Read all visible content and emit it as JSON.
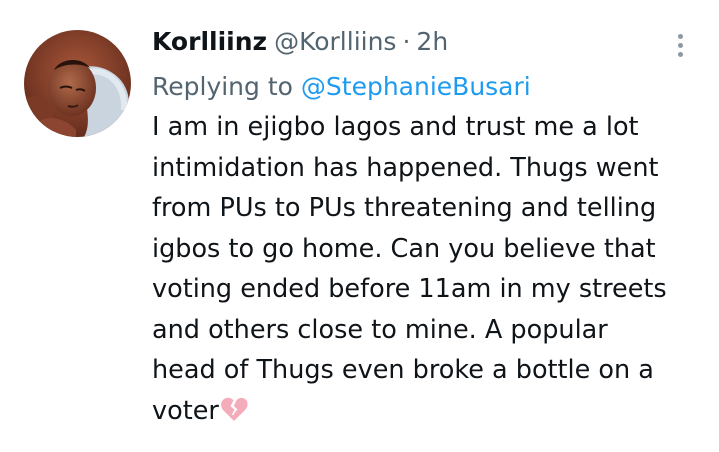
{
  "author": {
    "display_name": "Korlliinz",
    "handle": "@Korlliins",
    "separator": "·",
    "timestamp": "2h"
  },
  "reply": {
    "prefix": "Replying to",
    "mention": "@StephanieBusari"
  },
  "tweet": {
    "lines": [
      "I am in ejigbo lagos and trust me a lot",
      "intimidation has happened. Thugs went",
      "from PUs to PUs threatening and telling",
      "igbos to go home. Can you believe that",
      "voting ended before 11am in my streets",
      "and others close to mine. A popular",
      "head of Thugs even broke a bottle on a",
      "voter"
    ],
    "emoji": "broken-heart-icon"
  },
  "colors": {
    "name": "#0f1419",
    "secondary": "#536471",
    "link": "#1d9bf0",
    "emoji": "#f4abba"
  }
}
